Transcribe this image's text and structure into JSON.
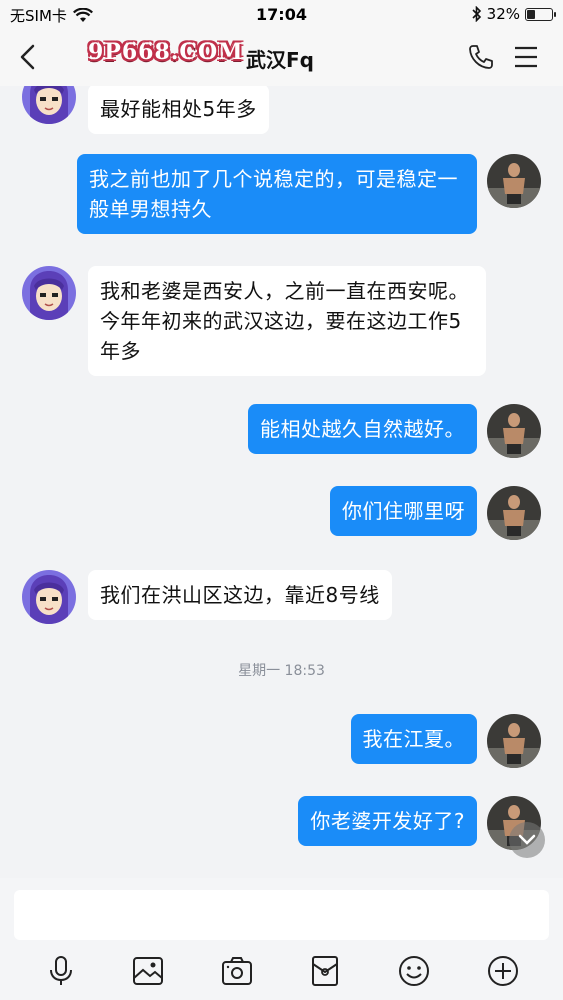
{
  "status_bar": {
    "carrier": "无SIM卡",
    "time": "17:04",
    "battery_percent_label": "32%",
    "battery_level": 0.32
  },
  "nav": {
    "brand_watermark": "9P668.COM",
    "title": "武汉Fq"
  },
  "messages": [
    {
      "side": "in",
      "text": "最好能相处5年多"
    },
    {
      "side": "out",
      "text": "我之前也加了几个说稳定的，可是稳定一般单男想持久"
    },
    {
      "side": "in",
      "text": "我和老婆是西安人，之前一直在西安呢。今年年初来的武汉这边，要在这边工作5年多"
    },
    {
      "side": "out",
      "text": "能相处越久自然越好。"
    },
    {
      "side": "out",
      "text": "你们住哪里呀"
    },
    {
      "side": "in",
      "text": "我们在洪山区这边，靠近8号线"
    },
    {
      "side": "time",
      "text": "星期一 18:53"
    },
    {
      "side": "out",
      "text": "我在江夏。"
    },
    {
      "side": "out",
      "text": "你老婆开发好了?"
    }
  ],
  "input": {
    "placeholder": ""
  },
  "colors": {
    "outgoing_bubble": "#1a8cf8",
    "incoming_bubble": "#ffffff",
    "background": "#f2f3f5",
    "brand_red": "#c0304a"
  },
  "icons": {
    "toolbar": [
      "microphone-icon",
      "image-icon",
      "camera-icon",
      "red-packet-icon",
      "emoji-icon",
      "plus-icon"
    ]
  }
}
